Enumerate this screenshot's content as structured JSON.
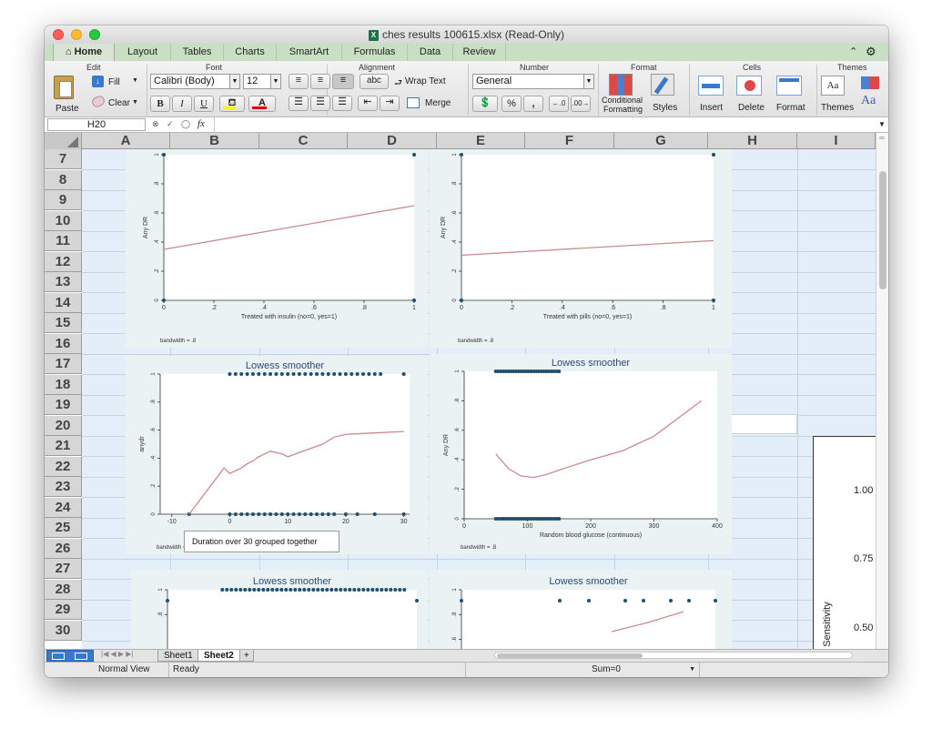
{
  "window": {
    "title": "ches results 100615.xlsx  (Read-Only)"
  },
  "ribbon_tabs": [
    "Home",
    "Layout",
    "Tables",
    "Charts",
    "SmartArt",
    "Formulas",
    "Data",
    "Review"
  ],
  "ribbon": {
    "groups": {
      "edit": "Edit",
      "font": "Font",
      "alignment": "Alignment",
      "number": "Number",
      "format": "Format",
      "cells": "Cells",
      "themes": "Themes"
    },
    "paste": "Paste",
    "fill": "Fill",
    "clear": "Clear",
    "font_name": "Calibri (Body)",
    "font_size": "12",
    "bold": "B",
    "italic": "I",
    "underline": "U",
    "font_color": "A",
    "abc": "abc",
    "wrap_text": "Wrap Text",
    "merge": "Merge",
    "number_format": "General",
    "percent": "%",
    "comma": ",",
    "conditional_formatting": [
      "Conditional",
      "Formatting"
    ],
    "styles": "Styles",
    "insert": "Insert",
    "delete": "Delete",
    "format": "Format",
    "themes": "Themes",
    "themes_aa": "Aa",
    "fonts_aa": "Aa"
  },
  "formula_bar": {
    "name_box": "H20",
    "fx": "fx",
    "value": ""
  },
  "columns": [
    "A",
    "B",
    "C",
    "D",
    "E",
    "F",
    "G",
    "H",
    "I"
  ],
  "rows": [
    "7",
    "8",
    "9",
    "10",
    "11",
    "12",
    "13",
    "14",
    "15",
    "16",
    "17",
    "18",
    "19",
    "20",
    "21",
    "22",
    "23",
    "24",
    "25",
    "26",
    "27",
    "28",
    "29",
    "30"
  ],
  "charts": [
    {
      "title": "",
      "xlabel": "Treated with insulin (no=0, yes=1)",
      "ylabel": "Any DR",
      "note": "bandwidth = .8",
      "chart_data": {
        "type": "scatter",
        "x": [
          0,
          1,
          0,
          1
        ],
        "y": [
          1,
          1,
          0,
          0
        ],
        "smoother": {
          "x": [
            0,
            1
          ],
          "y": [
            0.35,
            0.65
          ]
        },
        "xticks": [
          "0",
          ".2",
          ".4",
          ".6",
          ".8",
          "1"
        ],
        "yticks": [
          "0",
          ".2",
          ".4",
          ".6",
          ".8",
          "1"
        ]
      }
    },
    {
      "title": "",
      "xlabel": "Treated with pills (no=0, yes=1)",
      "ylabel": "Any DR",
      "note": "bandwidth = .8",
      "chart_data": {
        "type": "scatter",
        "x": [
          0,
          1,
          0,
          1
        ],
        "y": [
          1,
          1,
          0,
          0
        ],
        "smoother": {
          "x": [
            0,
            1
          ],
          "y": [
            0.31,
            0.41
          ]
        },
        "xticks": [
          "0",
          ".2",
          ".4",
          ".6",
          ".8",
          "1"
        ],
        "yticks": [
          "0",
          ".2",
          ".4",
          ".6",
          ".8",
          "1"
        ]
      }
    },
    {
      "title": "Lowess smoother",
      "xlabel": "",
      "ylabel": "anydr",
      "note": "bandwidth = .8",
      "chart_data": {
        "type": "scatter",
        "xlim": [
          -12,
          31
        ],
        "ones_x": [
          0,
          1,
          2,
          3,
          4,
          5,
          6,
          7,
          8,
          9,
          10,
          11,
          12,
          13,
          14,
          15,
          16,
          17,
          18,
          19,
          20,
          21,
          22,
          23,
          24,
          25,
          26,
          30
        ],
        "zeros_x": [
          -7,
          0,
          1,
          2,
          3,
          4,
          5,
          6,
          7,
          8,
          9,
          10,
          11,
          12,
          13,
          14,
          15,
          16,
          17,
          18,
          20,
          22,
          25,
          30
        ],
        "smoother": {
          "x": [
            -7,
            -1,
            0,
            1,
            2,
            3,
            4,
            5,
            6,
            7,
            8,
            9,
            10,
            12,
            14,
            16,
            18,
            20,
            25,
            30
          ],
          "y": [
            0,
            0.33,
            0.29,
            0.31,
            0.33,
            0.36,
            0.38,
            0.41,
            0.43,
            0.45,
            0.44,
            0.43,
            0.41,
            0.44,
            0.47,
            0.5,
            0.55,
            0.57,
            0.58,
            0.59
          ]
        },
        "xticks": [
          "-10",
          "0",
          "10",
          "20",
          "30"
        ],
        "yticks": [
          "0",
          ".2",
          ".4",
          ".6",
          ".8",
          "1"
        ]
      }
    },
    {
      "title": "Lowess smoother",
      "xlabel": "Random blood glucose (continuous)",
      "ylabel": "Any DR",
      "note": "bandwidth = .8",
      "chart_data": {
        "type": "scatter",
        "xlim": [
          0,
          400
        ],
        "smoother": {
          "x": [
            50,
            70,
            90,
            110,
            130,
            150,
            200,
            250,
            300,
            350,
            375
          ],
          "y": [
            0.44,
            0.34,
            0.29,
            0.28,
            0.3,
            0.33,
            0.4,
            0.46,
            0.56,
            0.72,
            0.8
          ]
        },
        "xticks": [
          "0",
          "100",
          "200",
          "300",
          "400"
        ],
        "yticks": [
          "0",
          ".2",
          ".4",
          ".6",
          ".8",
          "1"
        ]
      }
    },
    {
      "title": "Lowess smoother",
      "xlabel": "",
      "ylabel": "",
      "note": "",
      "chart_data": {
        "type": "scatter",
        "yticks": [
          "1",
          ".8"
        ]
      }
    },
    {
      "title": "Lowess smoother",
      "xlabel": "",
      "ylabel": "",
      "note": "",
      "chart_data": {
        "type": "scatter",
        "yticks": [
          "1",
          ".8",
          ".6"
        ]
      }
    }
  ],
  "comment": "Duration over 30 grouped together",
  "right_chart": {
    "ylabel": "Sensitivity",
    "yticks": [
      "1.00",
      "0.75",
      "0.50"
    ]
  },
  "sheets": [
    "Sheet1",
    "Sheet2"
  ],
  "status": {
    "view": "Normal View",
    "ready": "Ready",
    "sum": "Sum=0"
  }
}
